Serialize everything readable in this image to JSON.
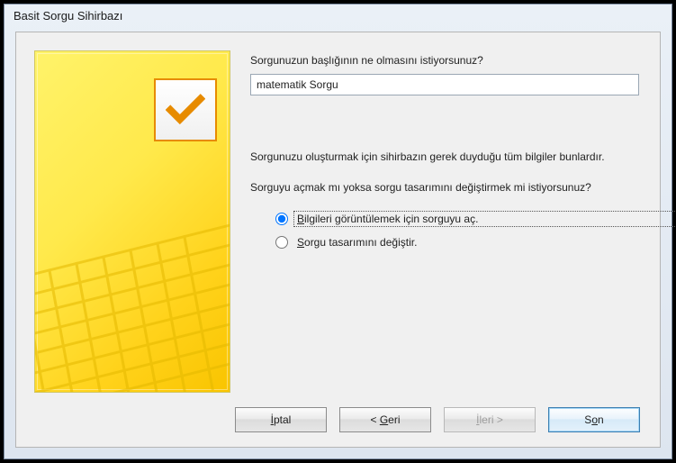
{
  "window": {
    "title": "Basit Sorgu Sihirbazı"
  },
  "main": {
    "question_title": "Sorgunuzun başlığının ne olmasını istiyorsunuz?",
    "title_value": "matematik Sorgu",
    "info_line1": "Sorgunuzu oluşturmak için sihirbazın gerek duyduğu tüm bilgiler bunlardır.",
    "question_action": "Sorguyu açmak mı yoksa sorgu tasarımını değiştirmek mi istiyorsunuz?",
    "radios": {
      "open": {
        "pre": "",
        "key": "B",
        "rest": "ilgileri görüntülemek için sorguyu aç."
      },
      "modify": {
        "pre": "",
        "key": "S",
        "rest": "orgu tasarımını değiştir."
      }
    }
  },
  "buttons": {
    "cancel": {
      "key": "İ",
      "rest": "ptal"
    },
    "back_pre": "< ",
    "back": {
      "key": "G",
      "rest": "eri"
    },
    "next": {
      "key": "İ",
      "rest": "leri >"
    },
    "finish_pre": "S",
    "finish": {
      "key": "o",
      "rest": "n"
    }
  }
}
